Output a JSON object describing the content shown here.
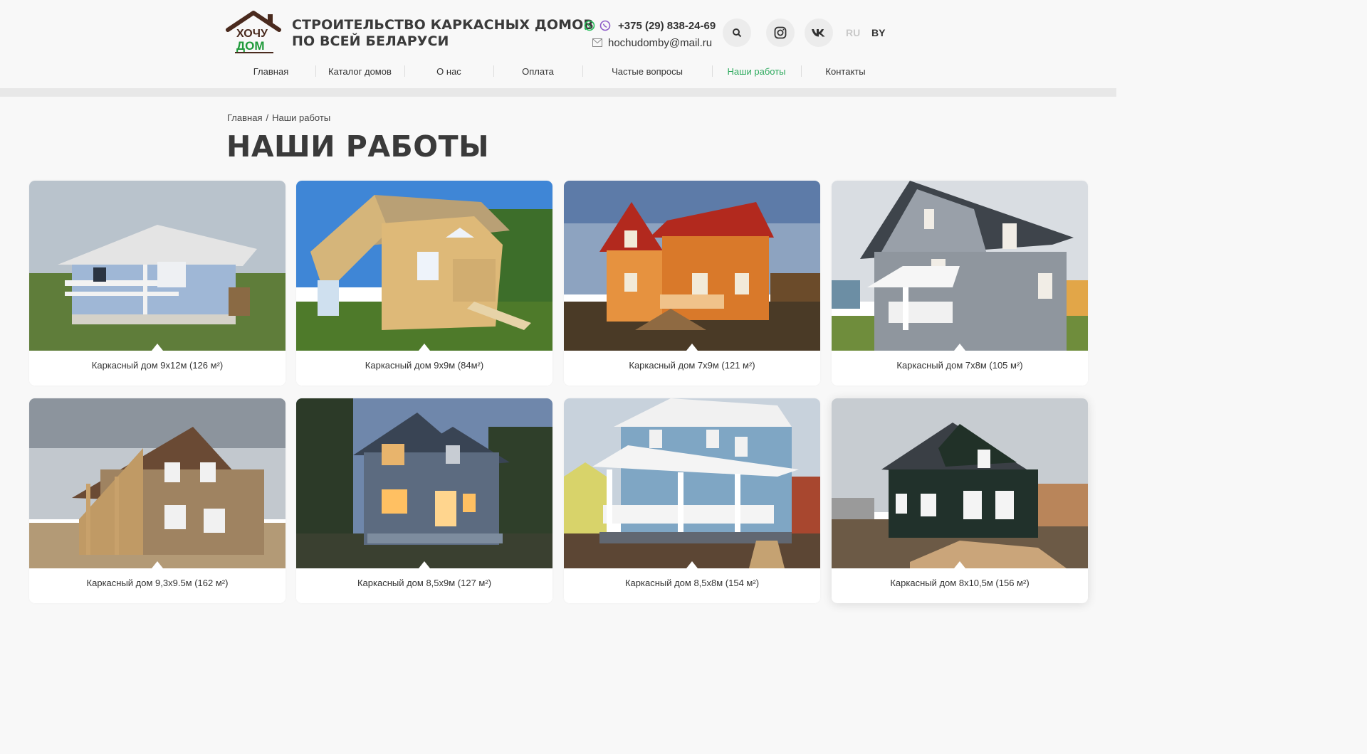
{
  "brand": {
    "logo_text_top": "ХОЧУ",
    "logo_text_bottom": "ДОМ",
    "tagline_line1": "СТРОИТЕЛЬСТВО КАРКАСНЫХ ДОМОВ",
    "tagline_line2": "ПО ВСЕЙ БЕЛАРУСИ",
    "accent_color": "#2eaa5e",
    "roof_color": "#4a2a1e"
  },
  "contacts": {
    "phone": "+375 (29) 838-24-69",
    "email": "hochudomby@mail.ru"
  },
  "languages": [
    "RU",
    "BY"
  ],
  "nav": {
    "items": [
      {
        "label": "Главная"
      },
      {
        "label": "Каталог домов"
      },
      {
        "label": "О нас"
      },
      {
        "label": "Оплата"
      },
      {
        "label": "Частые вопросы"
      },
      {
        "label": "Наши работы",
        "active": true
      },
      {
        "label": "Контакты"
      }
    ]
  },
  "breadcrumb": {
    "home": "Главная",
    "separator": "/",
    "current": "Наши работы"
  },
  "page_title": "НАШИ РАБОТЫ",
  "works": [
    {
      "caption": "Каркасный дом 9x12м (126 м²)"
    },
    {
      "caption": "Каркасный дом 9x9м (84м²)"
    },
    {
      "caption": "Каркасный дом 7x9м (121 м²)"
    },
    {
      "caption": "Каркасный дом 7x8м (105 м²)"
    },
    {
      "caption": "Каркасный дом 9,3x9.5м (162 м²)"
    },
    {
      "caption": "Каркасный дом 8,5x9м (127 м²)"
    },
    {
      "caption": "Каркасный дом 8,5x8м (154 м²)"
    },
    {
      "caption": "Каркасный дом 8x10,5м (156 м²)"
    }
  ]
}
